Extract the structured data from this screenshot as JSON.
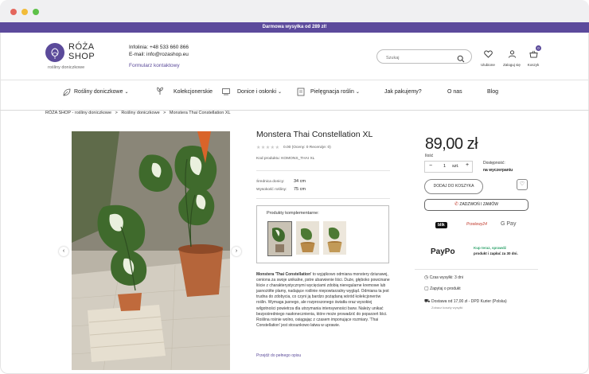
{
  "promo_bar": {
    "text": "Darmowa wysyłka od 289 zł!"
  },
  "brand": {
    "name_line1": "RÓŻA",
    "name_line2": "SHOP",
    "subtitle": "rośliny doniczkowe"
  },
  "contact": {
    "phone": "Infolinia: +48 533 660 866",
    "email": "E-mail: info@rozashop.eu",
    "form_link": "Formularz kontaktowy"
  },
  "search": {
    "placeholder": "Szukaj"
  },
  "header_icons": [
    {
      "label": "Ulubione",
      "icon": "heart-icon"
    },
    {
      "label": "Zaloguj się",
      "icon": "user-icon"
    },
    {
      "label": "Koszyk",
      "icon": "basket-icon",
      "badge": "0"
    }
  ],
  "nav": {
    "items": [
      {
        "label": "Rośliny doniczkowe",
        "has_dropdown": true
      },
      {
        "label": "Kolekcjonerskie",
        "has_dropdown": false
      },
      {
        "label": "Donice i osłonki",
        "has_dropdown": true
      },
      {
        "label": "Pielęgnacja roślin",
        "has_dropdown": true
      },
      {
        "label": "Jak pakujemy?",
        "has_dropdown": false
      },
      {
        "label": "O nas",
        "has_dropdown": false
      },
      {
        "label": "Blog",
        "has_dropdown": false
      }
    ]
  },
  "breadcrumb": {
    "items": [
      "RÓŻA SHOP - rośliny doniczkowe",
      "Rośliny doniczkowe",
      "Monstera Thai Constellation XL"
    ],
    "separator": ">"
  },
  "gallery": {
    "prev": "‹",
    "next": "›"
  },
  "product": {
    "title": "Monstera Thai Constellation XL",
    "rating_text": "0.00 (Oceny: 0 Recenzje: 0)",
    "stars": 0,
    "code": "Kod produktu: KOMONS_THAI XL",
    "pot_diameter_label": "Średnica donicy:",
    "pot_diameter_value": "34 cm",
    "height_label": "Wysokość rośliny:",
    "height_value": "75 cm",
    "complementary_title": "Produkty komplementarne:",
    "description_bold": "Monstera 'Thai Constellation'",
    "description": " to wyjątkowo odmiana monstery dziurawej, ceniona za swoje unikalne, pstre ubarwienie liści. Duże, głęboko powcinane liście z charakterystycznymi wycięciami zdobią nieregularne kremowe lub jasnożółte plamy, nadające roślinie niepowtarzalny wygląd. Odmiana ta jest trudna do zdobycia, co czyni ją bardzo pożądaną wśród kolekcjonerów roślin. Wymaga jasnego, ale rozproszonego światła oraz wysokiej wilgotności powietrza dla utrzymania intensywności barw. Należy unikać bezpośredniego nasłonecznienia, które może prowadzić do poparzeń liści. Roślina rośnie wolno, osiągając z czasem imponujące rozmiary. 'Thai Constellation' jest stosunkowo łatwa w uprawie.",
    "full_desc_link": "Przejdź do pełnego opisu"
  },
  "purchase": {
    "price": "89,00 zł",
    "qty_label": "Ilość",
    "qty_value": "1",
    "qty_unit": "szt.",
    "availability_label": "Dostępność:",
    "availability_value": "na wyczerpaniu",
    "add_to_cart": "DODAJ DO KOSZYKA",
    "call_order": "ZADZWOŃ I ZAMÓW",
    "payments": [
      "blik",
      "Przelewy24",
      "G Pay"
    ],
    "paypo_brand": "PayPo",
    "paypo_text_1": "Kup teraz, sprawdź",
    "paypo_text_2": "produkt i zapłać za 30 dni.",
    "shipping_time": "Czas wysyłki: 3 dni",
    "ask_about": "Zapytaj o produkt",
    "delivery_line": "Dostawa od 17,00 zł - DPD Kurier (Polska)",
    "delivery_sub": "Zobacz koszty wysyłki"
  },
  "colors": {
    "accent": "#5b4a9a",
    "promo_bg": "#5c4a9c"
  }
}
